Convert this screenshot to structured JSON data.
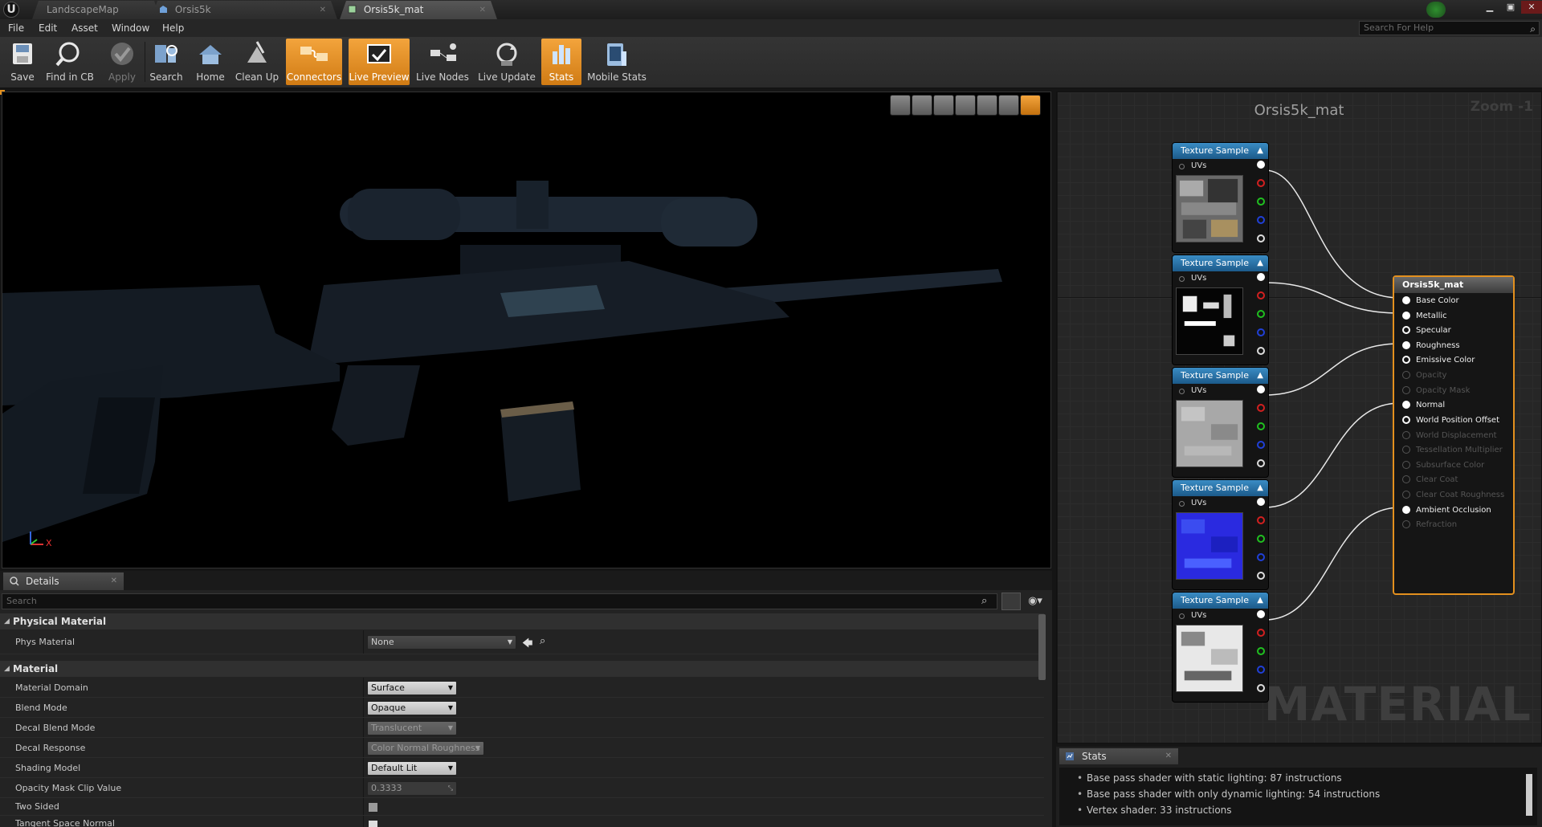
{
  "tabs": [
    {
      "label": "LandscapeMap"
    },
    {
      "label": "Orsis5k"
    },
    {
      "label": "Orsis5k_mat"
    }
  ],
  "menu": [
    "File",
    "Edit",
    "Asset",
    "Window",
    "Help"
  ],
  "help_search": {
    "placeholder": "Search For Help"
  },
  "toolbar": [
    {
      "label": "Save",
      "icon": "save-icon"
    },
    {
      "label": "Find in CB",
      "icon": "find-in-cb-icon"
    },
    {
      "label": "Apply",
      "icon": "apply-icon"
    },
    {
      "label": "Search",
      "icon": "search-icon"
    },
    {
      "label": "Home",
      "icon": "home-icon"
    },
    {
      "label": "Clean Up",
      "icon": "clean-up-icon"
    },
    {
      "label": "Connectors",
      "icon": "connectors-icon"
    },
    {
      "label": "Live Preview",
      "icon": "live-preview-icon"
    },
    {
      "label": "Live Nodes",
      "icon": "live-nodes-icon"
    },
    {
      "label": "Live Update",
      "icon": "live-update-icon"
    },
    {
      "label": "Stats",
      "icon": "stats-icon"
    },
    {
      "label": "Mobile Stats",
      "icon": "mobile-stats-icon"
    }
  ],
  "viewport": {
    "axis_x": "X"
  },
  "details": {
    "tab_label": "Details",
    "search_placeholder": "Search",
    "categories": {
      "physical": "Physical Material",
      "material": "Material"
    },
    "phys_material": {
      "name": "Phys Material",
      "value": "None"
    },
    "props": [
      {
        "name": "Material Domain",
        "value": "Surface"
      },
      {
        "name": "Blend Mode",
        "value": "Opaque"
      },
      {
        "name": "Decal Blend Mode",
        "value": "Translucent"
      },
      {
        "name": "Decal Response",
        "value": "Color Normal Roughness"
      },
      {
        "name": "Shading Model",
        "value": "Default Lit"
      },
      {
        "name": "Opacity Mask Clip Value",
        "value": "0.3333"
      },
      {
        "name": "Two Sided",
        "value": ""
      },
      {
        "name": "Tangent Space Normal",
        "value": ""
      }
    ]
  },
  "graph": {
    "title": "Orsis5k_mat",
    "zoom": "Zoom -1",
    "watermark": "MATERIAL",
    "texture_nodes": [
      {
        "title": "Texture Sample",
        "uv_label": "UVs"
      },
      {
        "title": "Texture Sample",
        "uv_label": "UVs"
      },
      {
        "title": "Texture Sample",
        "uv_label": "UVs"
      },
      {
        "title": "Texture Sample",
        "uv_label": "UVs"
      },
      {
        "title": "Texture Sample",
        "uv_label": "UVs"
      }
    ],
    "material_node": {
      "title": "Orsis5k_mat",
      "inputs": [
        {
          "label": "Base Color"
        },
        {
          "label": "Metallic"
        },
        {
          "label": "Specular"
        },
        {
          "label": "Roughness"
        },
        {
          "label": "Emissive Color"
        },
        {
          "label": "Opacity"
        },
        {
          "label": "Opacity Mask"
        },
        {
          "label": "Normal"
        },
        {
          "label": "World Position Offset"
        },
        {
          "label": "World Displacement"
        },
        {
          "label": "Tessellation Multiplier"
        },
        {
          "label": "Subsurface Color"
        },
        {
          "label": "Clear Coat"
        },
        {
          "label": "Clear Coat Roughness"
        },
        {
          "label": "Ambient Occlusion"
        },
        {
          "label": "Refraction"
        }
      ]
    }
  },
  "stats": {
    "tab_label": "Stats",
    "lines": [
      "Base pass shader with static lighting: 87 instructions",
      "Base pass shader with only dynamic lighting: 54 instructions",
      "Vertex shader: 33 instructions"
    ]
  },
  "colors": {
    "accent_orange": "#e3901e",
    "node_header_blue": "#2a75ad",
    "pin_red": "#d22020",
    "pin_green": "#20c020",
    "pin_blue": "#2040d8"
  }
}
